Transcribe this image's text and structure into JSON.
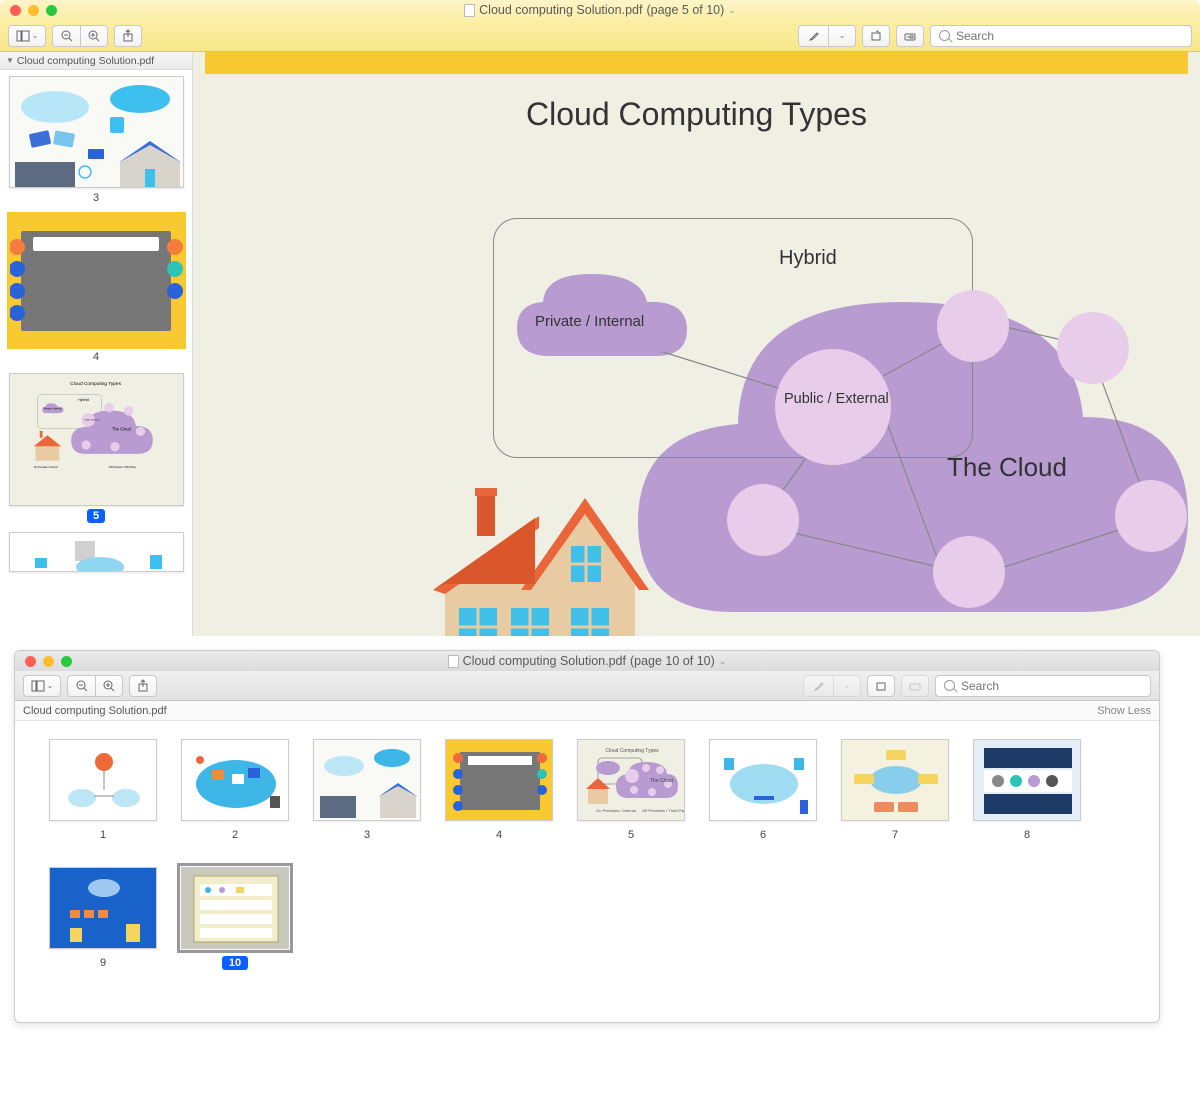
{
  "window1": {
    "title_prefix": "Cloud computing Solution.pdf",
    "title_page": "(page 5 of 10)",
    "search_placeholder": "Search",
    "sidebar_title": "Cloud computing Solution.pdf",
    "thumbs": [
      {
        "num": "3"
      },
      {
        "num": "4"
      },
      {
        "num": "5",
        "selected": true
      },
      {
        "num": ""
      }
    ]
  },
  "slide": {
    "title": "Cloud Computing Types",
    "hybrid": "Hybrid",
    "private": "Private / Internal",
    "public": "Public / External",
    "cloud": "The Cloud"
  },
  "window2": {
    "title_prefix": "Cloud computing Solution.pdf",
    "title_page": "(page 10 of 10)",
    "search_placeholder": "Search",
    "subbar_title": "Cloud computing Solution.pdf",
    "show_less": "Show Less",
    "thumbs": [
      {
        "num": "1"
      },
      {
        "num": "2"
      },
      {
        "num": "3"
      },
      {
        "num": "4"
      },
      {
        "num": "5"
      },
      {
        "num": "6"
      },
      {
        "num": "7"
      },
      {
        "num": "8"
      },
      {
        "num": "9"
      },
      {
        "num": "10",
        "selected": true
      }
    ]
  },
  "chart_data": {
    "type": "diagram",
    "title": "Cloud Computing Types",
    "groups": [
      "Private / Internal",
      "Hybrid",
      "Public / External",
      "The Cloud"
    ],
    "notes": "Hybrid container encloses Private cloud and overlaps Public/External node which is part of The Cloud network of 6 nodes"
  }
}
